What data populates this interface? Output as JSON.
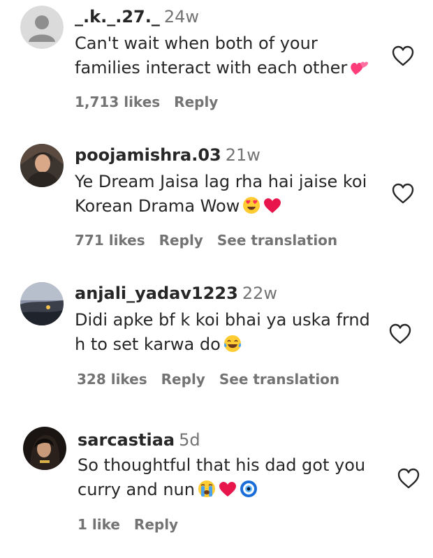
{
  "comments": [
    {
      "username": "_.k._.27._",
      "time": "24w",
      "line1": "Can't wait when both of your",
      "line2": "families interact with each other",
      "emojis": [
        "two-hearts"
      ],
      "likes": "1,713 likes",
      "reply": "Reply",
      "see_translation": ""
    },
    {
      "username": "poojamishra.03",
      "time": "21w",
      "line1": "Ye Dream Jaisa lag rha hai jaise koi",
      "line2": "Korean Drama Wow",
      "emojis": [
        "heart-eyes-emoji",
        "red-heart"
      ],
      "likes": "771 likes",
      "reply": "Reply",
      "see_translation": "See translation"
    },
    {
      "username": "anjali_yadav1223",
      "time": "22w",
      "line1": "Didi apke bf k koi bhai ya uska frnd",
      "line2": "h to set karwa do",
      "emojis": [
        "tears-of-joy"
      ],
      "likes": "328 likes",
      "reply": "Reply",
      "see_translation": "See translation"
    },
    {
      "username": "sarcastiaa",
      "time": "5d",
      "line1": "So thoughtful that his dad got you",
      "line2": "curry and nun",
      "emojis": [
        "crying-face",
        "red-heart",
        "nazar-amulet"
      ],
      "likes": "1 like",
      "reply": "Reply",
      "see_translation": ""
    }
  ],
  "colors": {
    "text": "#262626",
    "secondary": "#737373",
    "emoji_pink": "#ff3c7a",
    "heart_red": "#e8154d",
    "emoji_yellow": "#ffcc33",
    "nazar_blue": "#1a6ed8"
  }
}
